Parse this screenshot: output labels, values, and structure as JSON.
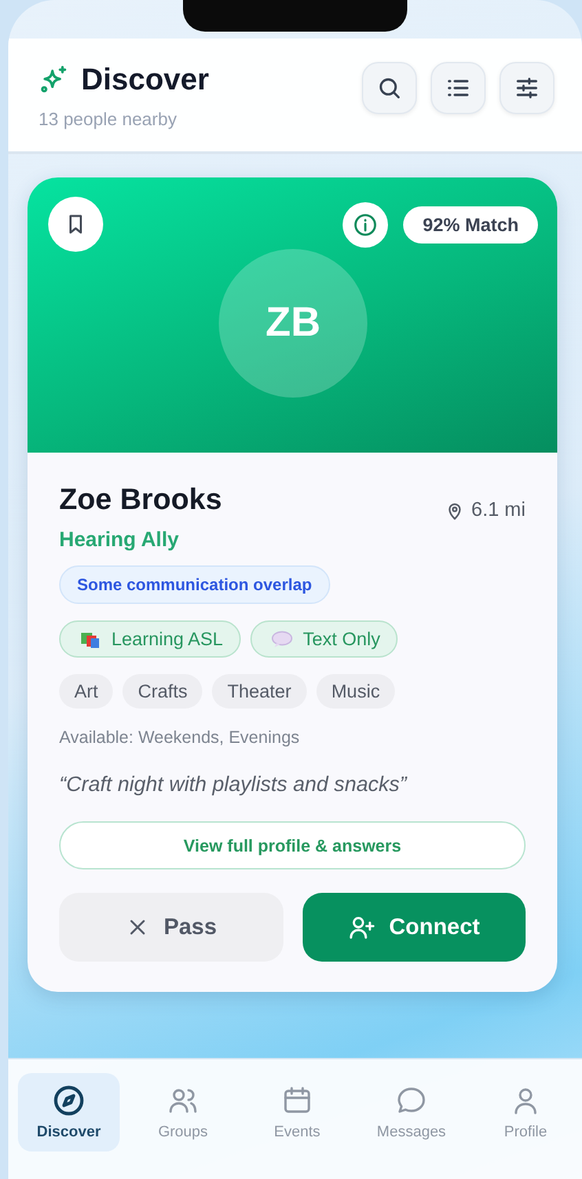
{
  "header": {
    "title": "Discover",
    "subtitle": "13 people nearby"
  },
  "profile": {
    "initials": "ZB",
    "match": "92% Match",
    "name": "Zoe Brooks",
    "role": "Hearing Ally",
    "distance": "6.1 mi",
    "overlap": "Some communication overlap",
    "modes": [
      {
        "label": "Learning ASL",
        "kind": "books"
      },
      {
        "label": "Text Only",
        "kind": "chat"
      }
    ],
    "interests": [
      "Art",
      "Crafts",
      "Theater",
      "Music"
    ],
    "availability": "Available: Weekends, Evenings",
    "quote": "“Craft night with playlists and snacks”",
    "view_button": "View full profile & answers",
    "pass_button": "Pass",
    "connect_button": "Connect"
  },
  "nav": [
    {
      "label": "Discover",
      "kind": "compass",
      "selected": true
    },
    {
      "label": "Groups",
      "kind": "people",
      "selected": false
    },
    {
      "label": "Events",
      "kind": "calendar",
      "selected": false
    },
    {
      "label": "Messages",
      "kind": "bubble",
      "selected": false
    },
    {
      "label": "Profile",
      "kind": "person",
      "selected": false
    }
  ]
}
